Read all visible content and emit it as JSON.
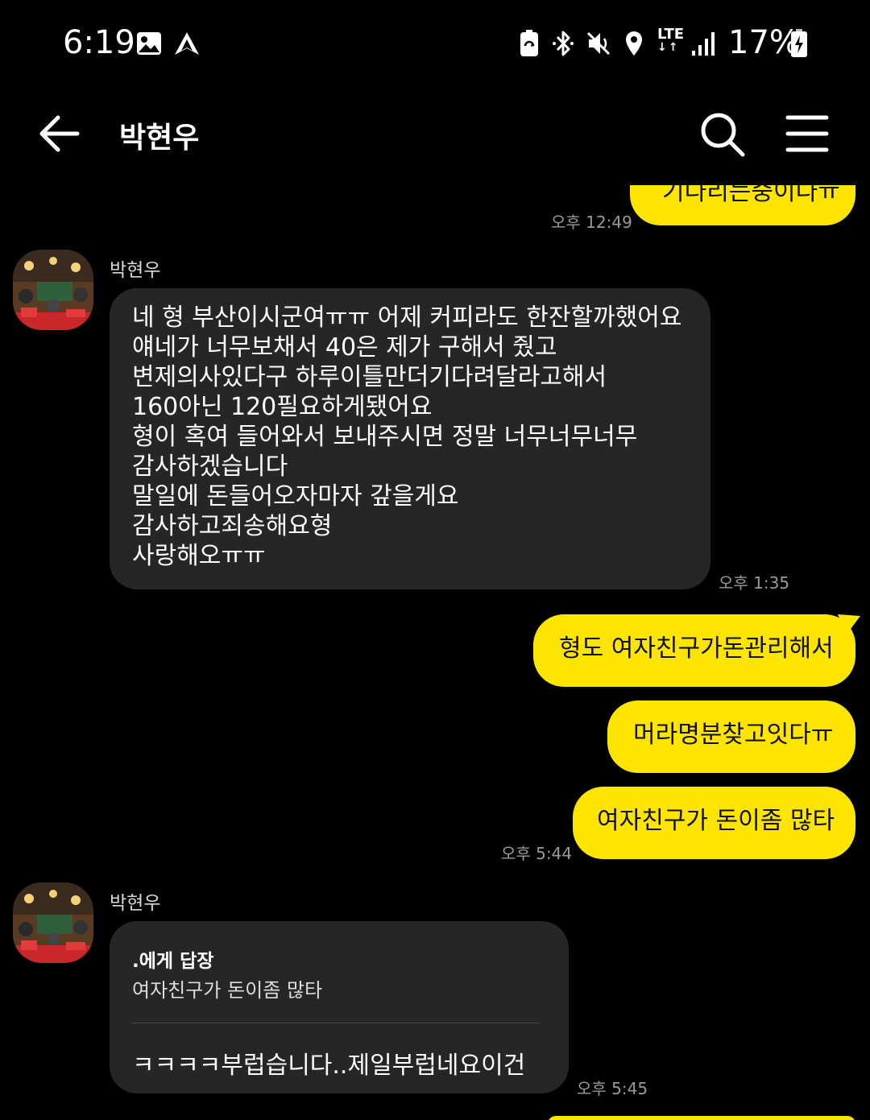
{
  "status": {
    "time": "6:19",
    "lte": "LTE",
    "battery": "17%",
    "icons": [
      "gallery-icon",
      "navigation-icon",
      "recycle-icon",
      "bluetooth-icon",
      "mute-icon",
      "location-icon",
      "signal-icon",
      "battery-charging-icon"
    ]
  },
  "header": {
    "title": "박현우",
    "back_icon": "arrow-left-icon",
    "search_icon": "search-icon",
    "menu_icon": "hamburger-menu-icon"
  },
  "colors": {
    "mine_bubble": "#fee500",
    "other_bubble": "#262626",
    "background": "#000000"
  },
  "messages": {
    "m0": {
      "text": "기다리는중이다ㅠ",
      "time": "오후 12:49"
    },
    "m1": {
      "sender": "박현우",
      "lines": [
        "네 형 부산이시군여ㅠㅠ 어제 커피라도 한잔할까했어요",
        "얘네가 너무보채서 40은 제가 구해서 줬고",
        "변제의사있다구 하루이틀만더기다려달라고해서",
        "160아닌 120필요하게됐어요",
        "형이 혹여 들어와서 보내주시면 정말 너무너무너무",
        "감사하겠습니다",
        "말일에 돈들어오자마자 갚을게요",
        "감사하고죄송해요형",
        "사랑해오ㅠㅠ"
      ],
      "time": "오후 1:35"
    },
    "m2": {
      "text": "형도 여자친구가돈관리해서"
    },
    "m3": {
      "text": "머라명분찾고잇다ㅠ"
    },
    "m4": {
      "text": "여자친구가 돈이좀 많타",
      "time": "오후 5:44"
    },
    "m5": {
      "sender": "박현우",
      "reply_to": ".에게 답장",
      "quoted": "여자친구가 돈이좀 많타",
      "text": "ㅋㅋㅋㅋ부럽습니다..제일부럽네요이건",
      "time": "오후 5:45"
    }
  }
}
